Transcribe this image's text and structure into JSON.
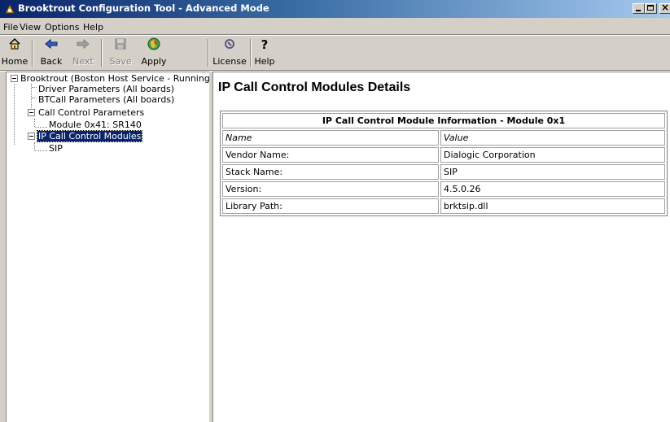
{
  "window": {
    "title": "Brooktrout Configuration Tool - Advanced Mode",
    "icon": "app-icon"
  },
  "menubar": {
    "items": [
      "File",
      "View",
      "Options",
      "Help"
    ]
  },
  "toolbar": {
    "buttons": [
      {
        "label": "Home",
        "icon": "home-icon",
        "enabled": true
      },
      {
        "label": "Back",
        "icon": "back-arrow-icon",
        "enabled": true
      },
      {
        "label": "Next",
        "icon": "forward-arrow-icon",
        "enabled": false
      },
      {
        "label": "Save",
        "icon": "save-disk-icon",
        "enabled": false
      },
      {
        "label": "Apply",
        "icon": "apply-icon",
        "enabled": true
      },
      {
        "label": "License",
        "icon": "license-icon",
        "enabled": true
      },
      {
        "label": "Help",
        "icon": "help-icon",
        "enabled": true
      }
    ]
  },
  "tree": {
    "root": "Brooktrout (Boston Host Service - Running)",
    "driver_params": "Driver Parameters (All boards)",
    "btcall_params": "BTCall Parameters (All boards)",
    "call_control": "Call Control Parameters",
    "module": "Module 0x41: SR140",
    "ip_call_control": "IP Call Control Modules",
    "sip": "SIP"
  },
  "content": {
    "heading": "IP Call Control Modules Details",
    "table": {
      "caption": "IP Call Control Module Information - Module 0x1",
      "columns": [
        "Name",
        "Value"
      ],
      "rows": [
        [
          "Vendor Name:",
          "Dialogic Corporation"
        ],
        [
          "Stack Name:",
          "SIP"
        ],
        [
          "Version:",
          "4.5.0.26"
        ],
        [
          "Library Path:",
          "brktsip.dll"
        ]
      ]
    }
  },
  "colors": {
    "titlebar_start": "#0a246a",
    "titlebar_end": "#a6caf0",
    "selection": "#0a246a",
    "chrome": "#d4d0c8"
  }
}
